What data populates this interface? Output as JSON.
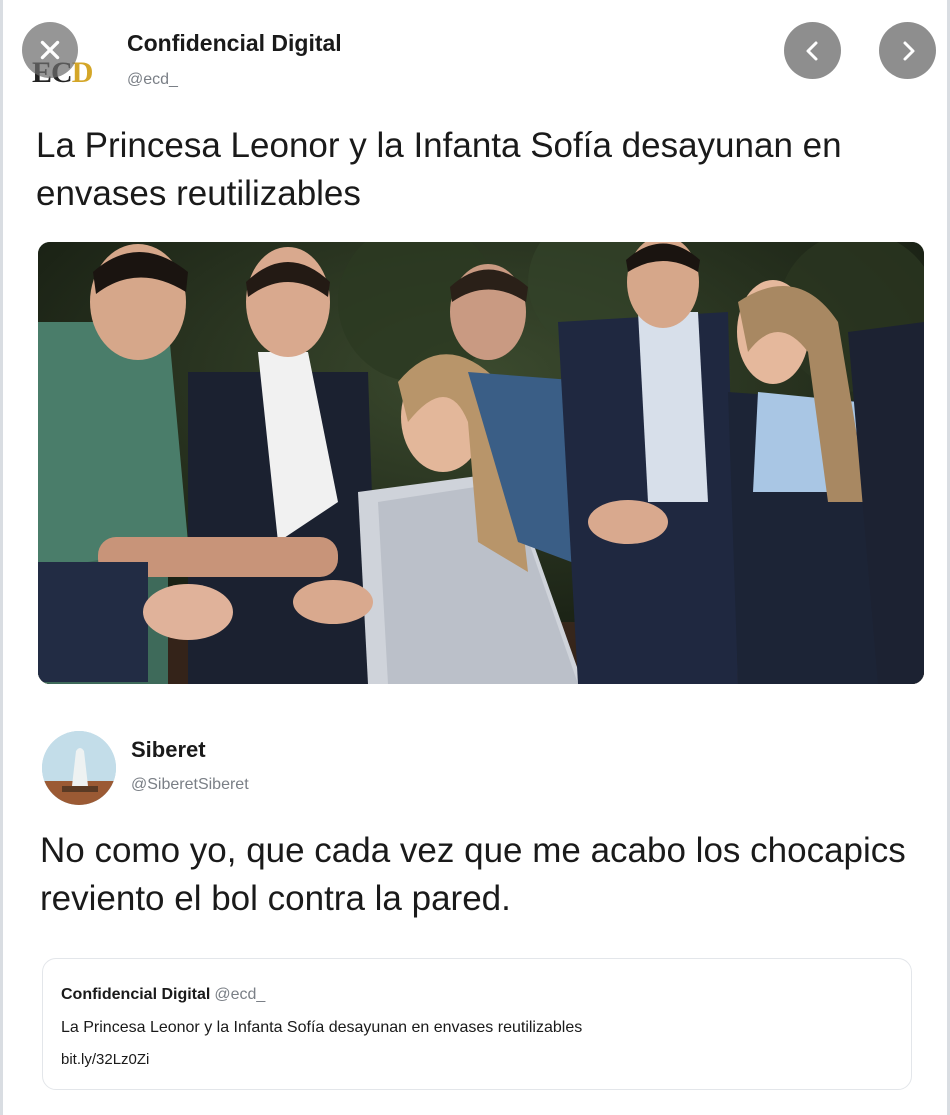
{
  "tweet": {
    "logo_text_main": "ECD",
    "author": "Confidencial Digital",
    "handle": "@ecd_",
    "headline": "La Princesa Leonor y la Infanta Sofía desayunan en envases reutilizables"
  },
  "viewer_controls": {
    "close_icon": "close-icon",
    "prev_icon": "chevron-left-icon",
    "next_icon": "chevron-right-icon"
  },
  "reply": {
    "author": "Siberet",
    "handle": "@SiberetSiberet",
    "text": "No como yo, que cada vez que me acabo los chocapics reviento el bol contra la pared."
  },
  "quoted": {
    "author": "Confidencial Digital",
    "handle": "@ecd_",
    "text": "La Princesa Leonor y la Infanta Sofía desayunan en envases reutilizables",
    "link": "bit.ly/32Lz0Zi"
  },
  "colors": {
    "button_gray": "#8e8e8e",
    "secondary_text": "#7a7f86",
    "logo_accent": "#d4a628"
  }
}
